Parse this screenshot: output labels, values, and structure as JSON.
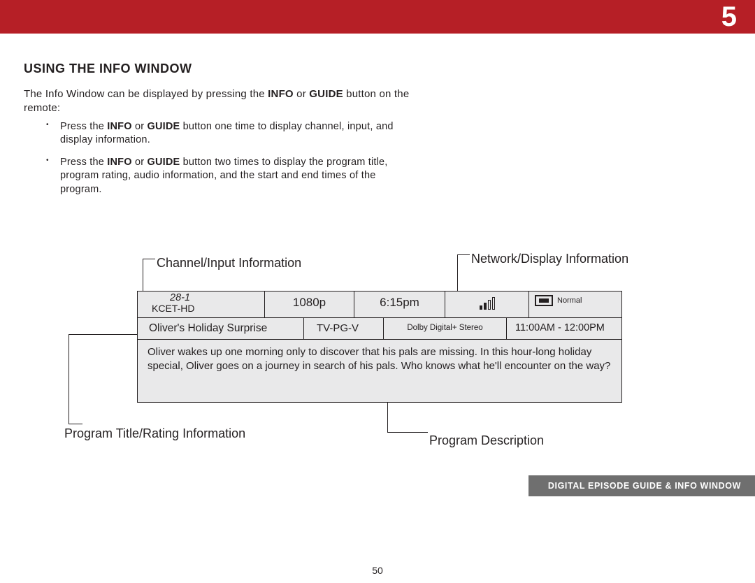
{
  "chapter_number": "5",
  "section_title": "USING THE INFO WINDOW",
  "intro_line1_pre": "The Info Window can be displayed by pressing the ",
  "intro_bold1": "INFO",
  "intro_or": " or ",
  "intro_bold2": "GUIDE",
  "intro_line1_post": " button on the remote:",
  "bullet1_pre": "Press the ",
  "bullet1_b1": "INFO",
  "bullet1_mid": " or ",
  "bullet1_b2": "GUIDE",
  "bullet1_post": " button one time to display channel, input, and display information.",
  "bullet2_pre": "Press the ",
  "bullet2_b1": "INFO",
  "bullet2_mid": " or ",
  "bullet2_b2": "GUIDE",
  "bullet2_post": " button two times to display the program title, program rating, audio information, and the start and end times of the program.",
  "callouts": {
    "channel_input": "Channel/Input Information",
    "network_display": "Network/Display Information",
    "program_title_rating": "Program Title/Rating Information",
    "program_description": "Program Description"
  },
  "info_box": {
    "channel_number": "28-1",
    "channel_name": "KCET-HD",
    "resolution": "1080p",
    "time": "6:15pm",
    "aspect_mode": "Normal",
    "program_title": "Oliver's Holiday Surprise",
    "rating": "TV-PG-V",
    "audio": "Dolby Digital+ Stereo",
    "program_time": "11:00AM - 12:00PM",
    "description": "Oliver wakes up one morning only to discover that his pals are missing. In this hour-long holiday special, Oliver goes on a journey in search of his pals. Who knows what he'll encounter on the way?"
  },
  "footer_tag": "DIGITAL EPISODE GUIDE & INFO WINDOW",
  "page_number": "50"
}
